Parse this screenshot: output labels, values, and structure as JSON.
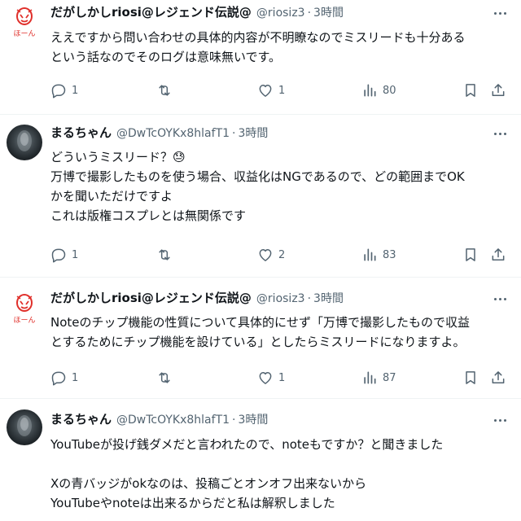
{
  "tweets": [
    {
      "name": "だがしかしriosi@レジェンド伝説@",
      "handle": "@riosiz3",
      "sep": "·",
      "time": "3時間",
      "avatar_icon": "hoon-logo-avatar",
      "avatar_text": "ほーん",
      "lines": [
        "ええですから問い合わせの具体的内容が不明瞭なのでミスリードも十分ある",
        "という話なのでそのログは意味無いです。"
      ],
      "replies": "1",
      "retweets": "",
      "likes": "1",
      "views": "80"
    },
    {
      "name": "まるちゃん",
      "handle": "@DwTcOYKx8hlafT1",
      "sep": "·",
      "time": "3時間",
      "avatar_icon": "dark-photo-avatar",
      "lines": [
        "どういうミスリード？😓",
        "万博で撮影したものを使う場合、収益化はNGであるので、どの範囲までOK",
        "かを聞いただけですよ",
        "これは版権コスプレとは無関係です"
      ],
      "replies": "1",
      "retweets": "",
      "likes": "2",
      "views": "83"
    },
    {
      "name": "だがしかしriosi@レジェンド伝説@",
      "handle": "@riosiz3",
      "sep": "·",
      "time": "3時間",
      "avatar_icon": "hoon-logo-avatar",
      "avatar_text": "ほーん",
      "lines": [
        "Noteのチップ機能の性質について具体的にせず「万博で撮影したもので収益",
        "とするためにチップ機能を設けている」としたらミスリードになりますよ。"
      ],
      "replies": "1",
      "retweets": "",
      "likes": "1",
      "views": "87"
    },
    {
      "name": "まるちゃん",
      "handle": "@DwTcOYKx8hlafT1",
      "sep": "·",
      "time": "3時間",
      "avatar_icon": "dark-photo-avatar",
      "lines": [
        "YouTubeが投げ銭ダメだと言われたので、noteもですか？と聞きました",
        "",
        "Xの青バッジがokなのは、投稿ごとオンオフ出来ないから",
        "YouTubeやnoteは出来るからだと私は解釈しました"
      ]
    }
  ],
  "colors": {
    "text": "#0f1419",
    "muted": "#536471",
    "divider": "#eff3f4",
    "logo_red": "#e0302b"
  }
}
